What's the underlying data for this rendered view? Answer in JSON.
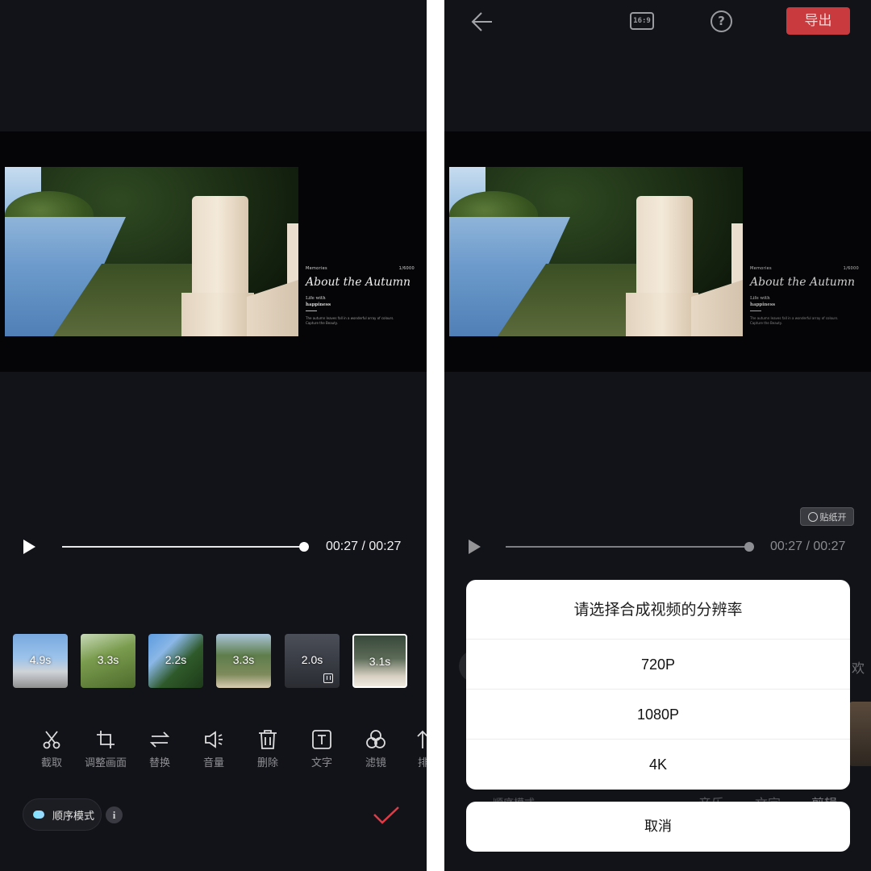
{
  "preview": {
    "caption": {
      "memories": "Memories",
      "shutter": "1/6000",
      "script_title": "About the Autumn",
      "life_line1": "Life with",
      "life_line2": "happiness",
      "small_line1": "The autumn leaves fall in a wonderful array of colours.",
      "small_line2": "Capture the Beauty."
    }
  },
  "left": {
    "player": {
      "time": "00:27 / 00:27",
      "progress": 1.0
    },
    "clips": [
      {
        "duration": "4.9s"
      },
      {
        "duration": "3.3s"
      },
      {
        "duration": "2.2s"
      },
      {
        "duration": "3.3s"
      },
      {
        "duration": "2.0s"
      },
      {
        "duration": "3.1s"
      }
    ],
    "tools": [
      {
        "label": "截取",
        "icon": "scissors-icon"
      },
      {
        "label": "调整画面",
        "icon": "crop-icon"
      },
      {
        "label": "替换",
        "icon": "swap-icon"
      },
      {
        "label": "音量",
        "icon": "volume-icon"
      },
      {
        "label": "删除",
        "icon": "trash-icon"
      },
      {
        "label": "文字",
        "icon": "text-icon"
      },
      {
        "label": "滤镜",
        "icon": "filter-icon"
      },
      {
        "label": "排",
        "icon": "sort-icon"
      }
    ],
    "mode_label": "顺序模式",
    "info": "i"
  },
  "right": {
    "topbar": {
      "ratio": "16:9",
      "help": "?",
      "export": "导出"
    },
    "sticker_toggle": "贴纸开",
    "player": {
      "time": "00:27 / 00:27",
      "progress": 1.0
    },
    "peek": {
      "side_text": "欢",
      "bottom1": "顺序模式",
      "bottom2": "音乐",
      "bottom3": "文字",
      "bottom4": "剪辑"
    },
    "dialog": {
      "title": "请选择合成视频的分辨率",
      "options": [
        "720P",
        "1080P",
        "4K"
      ],
      "cancel": "取消"
    }
  },
  "colors": {
    "background": "#121318",
    "accent_red": "#c93a3e",
    "confirm_red": "#e23b45"
  }
}
